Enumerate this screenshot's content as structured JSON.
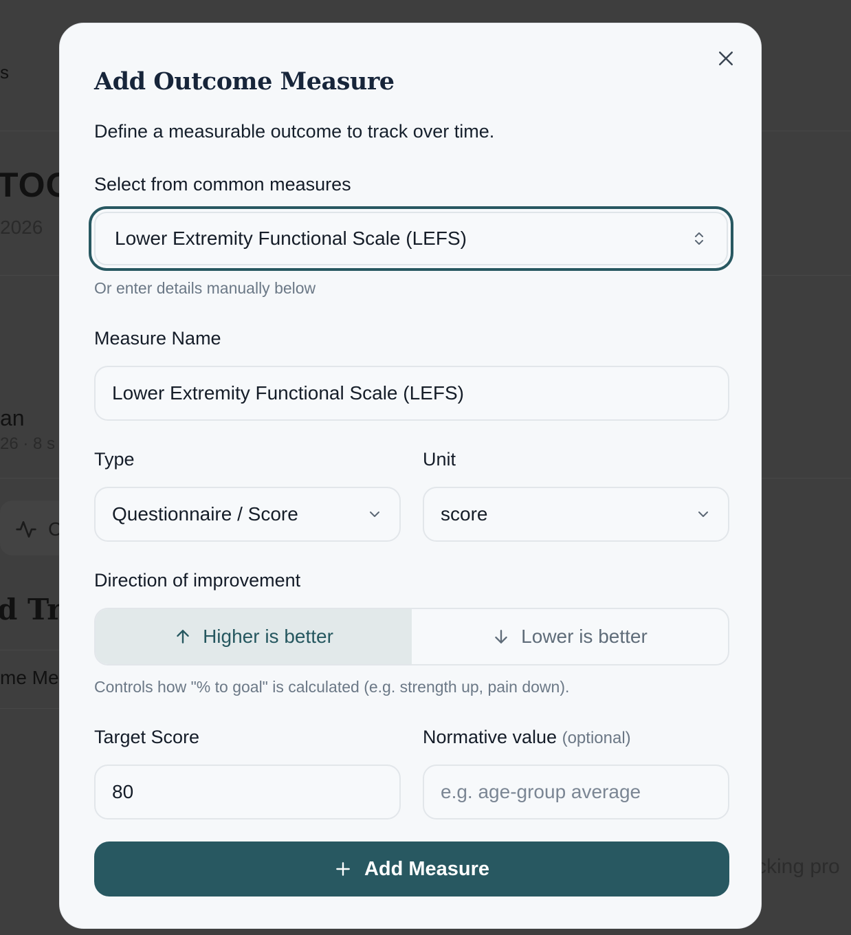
{
  "background": {
    "fragment_s": "s",
    "fragment_too": "TOO",
    "fragment_year": "2026",
    "fragment_plan": "an",
    "fragment_meta": "26 · 8 s",
    "fragment_c": "C",
    "fragment_tr": "d Tr",
    "fragment_measures": "me Mea",
    "fragment_tracking": "cking pro"
  },
  "modal": {
    "title": "Add Outcome Measure",
    "description": "Define a measurable outcome to track over time.",
    "common_measures": {
      "label": "Select from common measures",
      "selected": "Lower Extremity Functional Scale (LEFS)",
      "hint": "Or enter details manually below"
    },
    "measure_name": {
      "label": "Measure Name",
      "value": "Lower Extremity Functional Scale (LEFS)"
    },
    "type": {
      "label": "Type",
      "selected": "Questionnaire / Score"
    },
    "unit": {
      "label": "Unit",
      "selected": "score"
    },
    "direction": {
      "label": "Direction of improvement",
      "higher_label": "Higher is better",
      "lower_label": "Lower is better",
      "selected": "higher",
      "hint": "Controls how \"% to goal\" is calculated (e.g. strength up, pain down)."
    },
    "target": {
      "label": "Target Score",
      "value": "80"
    },
    "normative": {
      "label": "Normative value",
      "optional_tag": "(optional)",
      "placeholder": "e.g. age-group average"
    },
    "submit_label": "Add Measure"
  },
  "colors": {
    "primary": "#285861",
    "toggle_active_bg": "#e2e9ea",
    "overlay": "#3b3b3b",
    "modal_bg": "#f6f8fa"
  },
  "icons": {
    "close": "close-icon",
    "select_updown": "chevron-updown-icon",
    "dropdown": "chevron-down-icon",
    "higher": "arrow-up-icon",
    "lower": "arrow-down-icon",
    "add": "plus-icon",
    "activity": "activity-icon"
  }
}
